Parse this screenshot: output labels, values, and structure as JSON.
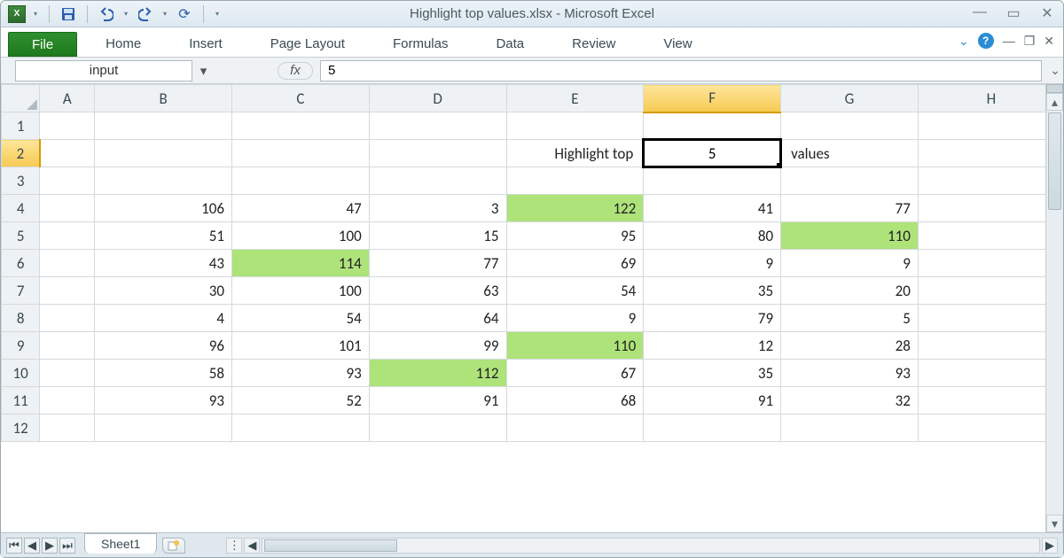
{
  "app_title": "Highlight top values.xlsx  -  Microsoft Excel",
  "ribbon": {
    "file": "File",
    "tabs": [
      "Home",
      "Insert",
      "Page Layout",
      "Formulas",
      "Data",
      "Review",
      "View"
    ]
  },
  "namebox": "input",
  "fx_label": "fx",
  "formula_value": "5",
  "columns": [
    "A",
    "B",
    "C",
    "D",
    "E",
    "F",
    "G",
    "H"
  ],
  "active_col": "F",
  "active_row": 2,
  "row_count": 12,
  "labels": {
    "highlight_top": "Highlight top",
    "values": "values",
    "selected_value": "5"
  },
  "data_start_row": 4,
  "data_cols": [
    "B",
    "C",
    "D",
    "E",
    "F",
    "G"
  ],
  "data": [
    [
      106,
      47,
      3,
      122,
      41,
      77
    ],
    [
      51,
      100,
      15,
      95,
      80,
      110
    ],
    [
      43,
      114,
      77,
      69,
      9,
      9
    ],
    [
      30,
      100,
      63,
      54,
      35,
      20
    ],
    [
      4,
      54,
      64,
      9,
      79,
      5
    ],
    [
      96,
      101,
      99,
      110,
      12,
      28
    ],
    [
      58,
      93,
      112,
      67,
      35,
      93
    ],
    [
      93,
      52,
      91,
      68,
      91,
      32
    ]
  ],
  "highlights": [
    {
      "r": 4,
      "c": "E"
    },
    {
      "r": 5,
      "c": "G"
    },
    {
      "r": 6,
      "c": "C"
    },
    {
      "r": 9,
      "c": "E"
    },
    {
      "r": 10,
      "c": "D"
    }
  ],
  "sheet_tab": "Sheet1",
  "colors": {
    "highlight": "#aee37a",
    "header_active": "#f6c951",
    "file_tab": "#1e7a1e"
  }
}
